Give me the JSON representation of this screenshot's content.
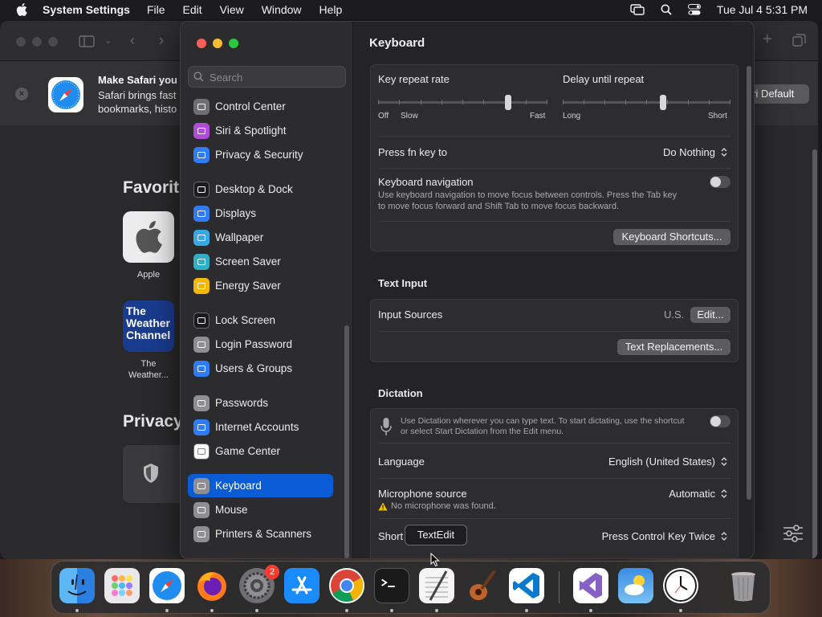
{
  "menubar": {
    "app_name": "System Settings",
    "menus": [
      "File",
      "Edit",
      "View",
      "Window",
      "Help"
    ],
    "clock": "Tue Jul 4  5:31 PM"
  },
  "safari": {
    "banner_title": "Make Safari you",
    "banner_text_1": "Safari brings fast",
    "banner_text_2": "bookmarks, histo",
    "default_button": "ari Default",
    "favorites_heading": "Favorit",
    "privacy_heading": "Privacy",
    "favorites": [
      {
        "label": "Apple"
      },
      {
        "label": "The\nWeather..."
      }
    ],
    "weather_logo_text": [
      "The",
      "Weather",
      "Channel"
    ]
  },
  "settings": {
    "search_placeholder": "Search",
    "sidebar": [
      {
        "label": "Control Center",
        "icon": "control-center-icon",
        "color": "#6e6e73"
      },
      {
        "label": "Siri & Spotlight",
        "icon": "siri-icon",
        "color": "#b04cd8"
      },
      {
        "label": "Privacy & Security",
        "icon": "hand-icon",
        "color": "#2f7cf6"
      },
      {
        "label": "Desktop & Dock",
        "icon": "desktop-dock-icon",
        "color": "#1c1c1e"
      },
      {
        "label": "Displays",
        "icon": "displays-icon",
        "color": "#2f7cf6"
      },
      {
        "label": "Wallpaper",
        "icon": "wallpaper-icon",
        "color": "#38a9e6"
      },
      {
        "label": "Screen Saver",
        "icon": "screen-saver-icon",
        "color": "#30b0c7"
      },
      {
        "label": "Energy Saver",
        "icon": "energy-icon",
        "color": "#f5b800"
      },
      {
        "label": "Lock Screen",
        "icon": "lock-icon",
        "color": "#1c1c1e"
      },
      {
        "label": "Login Password",
        "icon": "login-password-icon",
        "color": "#8e8e93"
      },
      {
        "label": "Users & Groups",
        "icon": "users-icon",
        "color": "#2f7cf6"
      },
      {
        "label": "Passwords",
        "icon": "key-icon",
        "color": "#8e8e93"
      },
      {
        "label": "Internet Accounts",
        "icon": "at-icon",
        "color": "#2f7cf6"
      },
      {
        "label": "Game Center",
        "icon": "game-center-icon",
        "color": "#ffffff"
      },
      {
        "label": "Keyboard",
        "icon": "keyboard-icon",
        "color": "#8e8e93",
        "active": true
      },
      {
        "label": "Mouse",
        "icon": "mouse-icon",
        "color": "#8e8e93"
      },
      {
        "label": "Printers & Scanners",
        "icon": "printer-icon",
        "color": "#8e8e93"
      }
    ],
    "title": "Keyboard",
    "key_repeat": {
      "label": "Key repeat rate",
      "off": "Off",
      "slow": "Slow",
      "fast": "Fast",
      "value_fraction": 0.78
    },
    "delay_repeat": {
      "label": "Delay until repeat",
      "long": "Long",
      "short": "Short",
      "value_fraction": 0.6
    },
    "fn_key": {
      "label": "Press fn key to",
      "value": "Do Nothing"
    },
    "keyboard_nav": {
      "label": "Keyboard navigation",
      "desc_1": "Use keyboard navigation to move focus between controls. Press the Tab key",
      "desc_2": "to move focus forward and Shift Tab to move focus backward.",
      "enabled": false
    },
    "shortcuts_button": "Keyboard Shortcuts...",
    "text_input_title": "Text Input",
    "input_sources": {
      "label": "Input Sources",
      "value": "U.S.",
      "edit_button": "Edit..."
    },
    "text_replacements_button": "Text Replacements...",
    "dictation_title": "Dictation",
    "dictation": {
      "desc_1": "Use Dictation wherever you can type text. To start dictating, use the shortcut",
      "desc_2": "or select Start Dictation from the Edit menu.",
      "enabled": false
    },
    "language": {
      "label": "Language",
      "value": "English (United States)"
    },
    "mic": {
      "label": "Microphone source",
      "value": "Automatic",
      "warning": "No microphone was found."
    },
    "shortcut": {
      "label": "Short",
      "value": "Press Control Key Twice"
    }
  },
  "tooltip": "TextEdit",
  "dock": {
    "apps": [
      "Finder",
      "Launchpad",
      "Safari",
      "Firefox",
      "System Settings",
      "App Store",
      "Chrome",
      "Terminal",
      "TextEdit",
      "GarageBand",
      "Visual Studio Code",
      "Visual Studio",
      "Weather",
      "Clock",
      "Trash"
    ],
    "settings_badge": "2"
  },
  "colors": {
    "accent": "#0a5bd6",
    "close": "#ff5f57",
    "minimize": "#febc2e",
    "zoom": "#28c840"
  }
}
